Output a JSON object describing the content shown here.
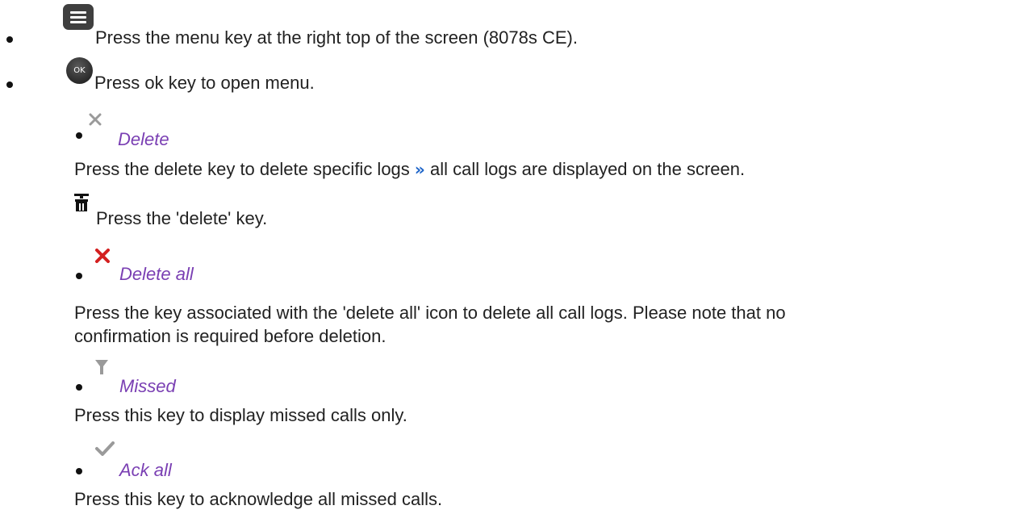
{
  "steps": [
    {
      "text": "Press the menu key at the right top of the screen (8078s CE).",
      "icon": "menu-key-icon"
    },
    {
      "text": "Press ok key to open menu.",
      "icon": "ok-key-icon",
      "icon_label": "OK"
    }
  ],
  "items": [
    {
      "title": "Delete",
      "icon": "delete-cross-gray-icon",
      "desc_before": "Press the delete key to delete specific logs",
      "desc_after": "all call logs are displayed on the screen.",
      "separator": "»",
      "sub": {
        "icon": "trash-icon",
        "text": "Press the 'delete' key."
      }
    },
    {
      "title": "Delete all",
      "icon": "delete-cross-red-icon",
      "desc_line1": "Press the key associated with the 'delete all' icon to delete all call logs. Please note that no",
      "desc_line2": "confirmation is required before deletion."
    },
    {
      "title": "Missed",
      "icon": "filter-icon",
      "desc": "Press this key to display missed calls only."
    },
    {
      "title": "Ack all",
      "icon": "checkmark-icon",
      "desc": "Press this key to acknowledge all missed calls."
    }
  ],
  "colors": {
    "title": "#7a3fb3",
    "separator": "#1d64c8",
    "red_cross": "#d42020",
    "gray_icon": "#9a9a9a"
  }
}
